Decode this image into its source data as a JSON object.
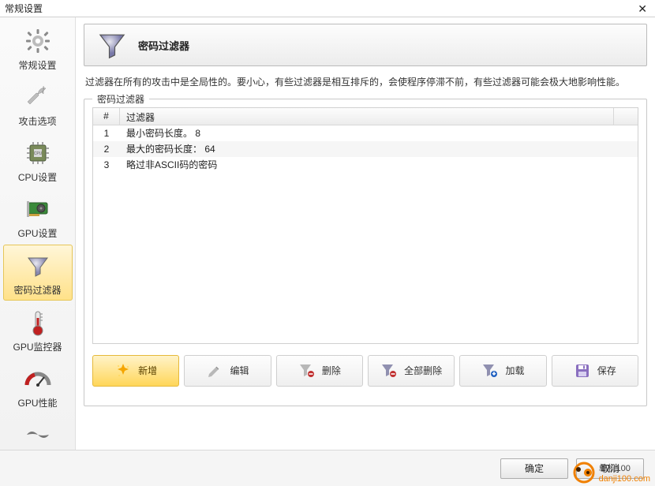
{
  "window": {
    "title": "常规设置"
  },
  "sidebar": {
    "items": [
      {
        "label": "常规设置"
      },
      {
        "label": "攻击选项"
      },
      {
        "label": "CPU设置"
      },
      {
        "label": "GPU设置"
      },
      {
        "label": "密码过滤器"
      },
      {
        "label": "GPU监控器"
      },
      {
        "label": "GPU性能"
      },
      {
        "label": ""
      }
    ],
    "selected_index": 4
  },
  "header": {
    "title": "密码过滤器"
  },
  "description": "过滤器在所有的攻击中是全局性的。要小心，有些过滤器是相互排斥的，会使程序停滞不前，有些过滤器可能会极大地影响性能。",
  "group": {
    "title": "密码过滤器"
  },
  "table": {
    "columns": {
      "num": "#",
      "name": "过滤器"
    },
    "rows": [
      {
        "num": "1",
        "name": "最小密码长度。 8"
      },
      {
        "num": "2",
        "name": "最大的密码长度： 64"
      },
      {
        "num": "3",
        "name": "略过非ASCII码的密码"
      }
    ]
  },
  "toolbar": {
    "new": "新增",
    "edit": "编辑",
    "delete": "删除",
    "delete_all": "全部删除",
    "load": "加载",
    "save": "保存"
  },
  "footer": {
    "ok": "确定",
    "cancel": "取消"
  },
  "watermark": {
    "text": "单机100",
    "url": "danji100.com"
  }
}
